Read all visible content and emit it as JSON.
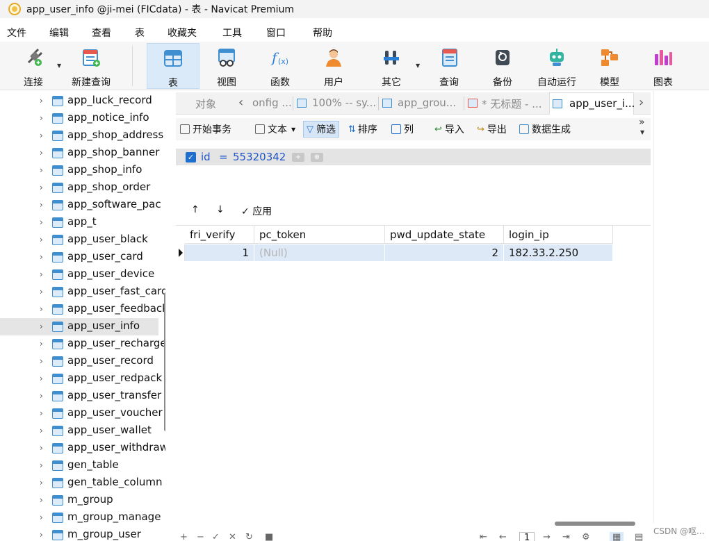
{
  "window": {
    "title": "app_user_info @ji-mei (FICdata) - 表 - Navicat Premium"
  },
  "menu": [
    "文件",
    "编辑",
    "查看",
    "表",
    "收藏夹",
    "工具",
    "窗口",
    "帮助"
  ],
  "toolbar": {
    "connect": "连接",
    "new_query": "新建查询",
    "table": "表",
    "view": "视图",
    "function": "函数",
    "user": "用户",
    "other": "其它",
    "query": "查询",
    "backup": "备份",
    "automation": "自动运行",
    "model": "模型",
    "chart": "图表"
  },
  "sidebar": {
    "items": [
      "app_luck_record",
      "app_notice_info",
      "app_shop_address",
      "app_shop_banner",
      "app_shop_info",
      "app_shop_order",
      "app_software_pac",
      "app_t",
      "app_user_black",
      "app_user_card",
      "app_user_device",
      "app_user_fast_card",
      "app_user_feedback",
      "app_user_info",
      "app_user_recharge",
      "app_user_record",
      "app_user_redpack",
      "app_user_transfer",
      "app_user_voucher",
      "app_user_wallet",
      "app_user_withdraw",
      "gen_table",
      "gen_table_column",
      "m_group",
      "m_group_manage",
      "m_group_user"
    ],
    "selected_index": 13
  },
  "tabs": {
    "objects": "对象",
    "t1": "onfig ...",
    "t2": "100% -- sy...",
    "t3": "app_grou...",
    "t4": "* 无标题 - ...",
    "t5": "app_user_i..."
  },
  "subtoolbar": {
    "begin_tx": "开始事务",
    "text": "文本",
    "filter": "筛选",
    "sort": "排序",
    "columns": "列",
    "import": "导入",
    "export": "导出",
    "datagen": "数据生成"
  },
  "filter": {
    "field": "id",
    "op": "=",
    "value": "55320342"
  },
  "apply": {
    "label": "应用"
  },
  "grid": {
    "columns": [
      "fri_verify",
      "pc_token",
      "pwd_update_state",
      "login_ip"
    ],
    "rows": [
      [
        "1",
        "(Null)",
        "2",
        "182.33.2.250"
      ]
    ]
  },
  "bottom": {
    "page": "1"
  },
  "watermark": "CSDN @呕..."
}
